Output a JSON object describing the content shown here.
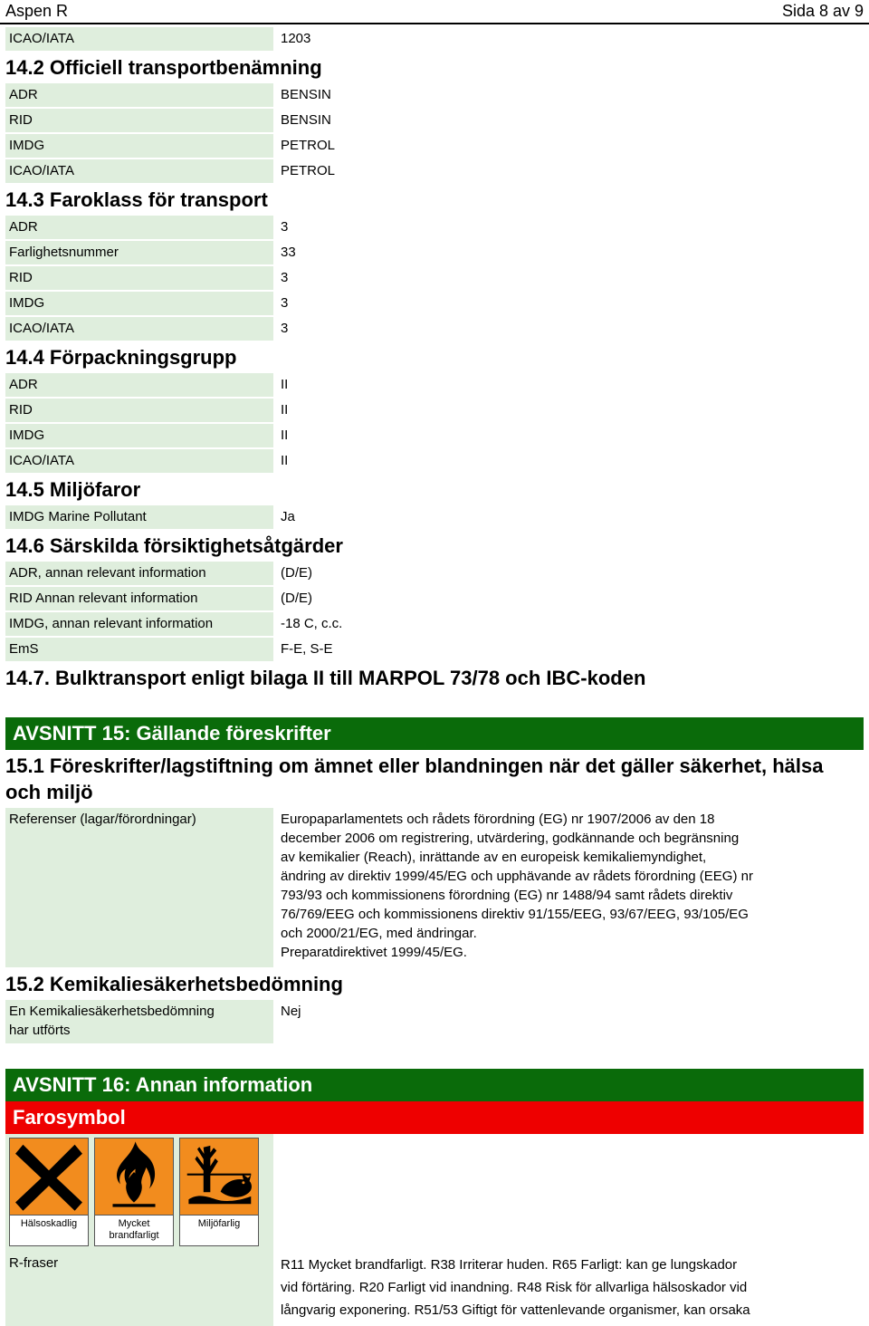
{
  "header": {
    "document_title": "Aspen R",
    "page_indicator": "Sida 8 av 9"
  },
  "sections": {
    "icao_un_row": {
      "label": "ICAO/IATA",
      "value": "1203"
    },
    "s14_2": {
      "heading": "14.2 Officiell transportbenämning",
      "rows": [
        {
          "label": "ADR",
          "value": "BENSIN"
        },
        {
          "label": "RID",
          "value": "BENSIN"
        },
        {
          "label": "IMDG",
          "value": "PETROL"
        },
        {
          "label": "ICAO/IATA",
          "value": "PETROL"
        }
      ]
    },
    "s14_3": {
      "heading": "14.3 Faroklass för transport",
      "rows": [
        {
          "label": "ADR",
          "value": "3"
        },
        {
          "label": "Farlighetsnummer",
          "value": "33"
        },
        {
          "label": "RID",
          "value": "3"
        },
        {
          "label": "IMDG",
          "value": "3"
        },
        {
          "label": "ICAO/IATA",
          "value": "3"
        }
      ]
    },
    "s14_4": {
      "heading": "14.4 Förpackningsgrupp",
      "rows": [
        {
          "label": "ADR",
          "value": "II"
        },
        {
          "label": "RID",
          "value": "II"
        },
        {
          "label": "IMDG",
          "value": "II"
        },
        {
          "label": "ICAO/IATA",
          "value": "II"
        }
      ]
    },
    "s14_5": {
      "heading": "14.5 Miljöfaror",
      "rows": [
        {
          "label": "IMDG Marine Pollutant",
          "value": "Ja"
        }
      ]
    },
    "s14_6": {
      "heading": "14.6 Särskilda försiktighetsåtgärder",
      "rows": [
        {
          "label": "ADR, annan relevant information",
          "value": "(D/E)"
        },
        {
          "label": "RID Annan relevant information",
          "value": "(D/E)"
        },
        {
          "label": "IMDG, annan relevant information",
          "value": "-18 C, c.c."
        },
        {
          "label": "EmS",
          "value": "F-E, S-E"
        }
      ]
    },
    "s14_7": {
      "heading": "14.7. Bulktransport enligt bilaga II till MARPOL 73/78 och IBC-koden"
    },
    "avsnitt15": {
      "bar_title": "AVSNITT 15: Gällande föreskrifter",
      "s15_1_heading": "15.1 Föreskrifter/lagstiftning om ämnet eller blandningen när det gäller säkerhet, hälsa och miljö",
      "references_label": "Referenser (lagar/förordningar)",
      "references_lines": [
        "Europaparlamentets och rådets förordning (EG) nr 1907/2006 av den 18",
        "december 2006 om registrering, utvärdering, godkännande och begränsning",
        "av kemikalier (Reach), inrättande av en europeisk kemikaliemyndighet,",
        "ändring av direktiv 1999/45/EG och upphävande av rådets förordning (EEG) nr",
        "793/93 och kommissionens förordning (EG) nr 1488/94 samt rådets direktiv",
        "76/769/EEG och kommissionens direktiv 91/155/EEG, 93/67/EEG, 93/105/EG",
        "och 2000/21/EG, med ändringar.",
        "Preparatdirektivet 1999/45/EG."
      ],
      "s15_2_heading": "15.2 Kemikaliesäkerhetsbedömning",
      "csa_label_line1": "En Kemikaliesäkerhetsbedömning",
      "csa_label_line2": "har utförts",
      "csa_value": "Nej"
    },
    "avsnitt16": {
      "bar_title": "AVSNITT 16: Annan information",
      "farosymbol_bar": "Farosymbol",
      "pictograms": [
        {
          "icon": "st-andrews-cross-icon",
          "caption": "Hälsoskadlig",
          "caption_line2": ""
        },
        {
          "icon": "flame-icon",
          "caption": "Mycket",
          "caption_line2": "brandfarligt"
        },
        {
          "icon": "dead-tree-fish-icon",
          "caption": "Miljöfarlig",
          "caption_line2": ""
        }
      ],
      "rfraser_label": "R-fraser",
      "rfraser_lines": [
        "R11 Mycket brandfarligt. R38 Irriterar huden. R65 Farligt: kan ge lungskador",
        "vid förtäring. R20 Farligt vid inandning. R48 Risk för allvarliga hälsoskador vid",
        "långvarig exponering. R51/53 Giftigt för vattenlevande organismer, kan orsaka"
      ]
    }
  },
  "colors": {
    "row_label_bg": "#dfeedd",
    "section_bar_green": "#0a6b0a",
    "section_bar_red": "#ee0000",
    "pictogram_orange": "#f28c1e"
  }
}
